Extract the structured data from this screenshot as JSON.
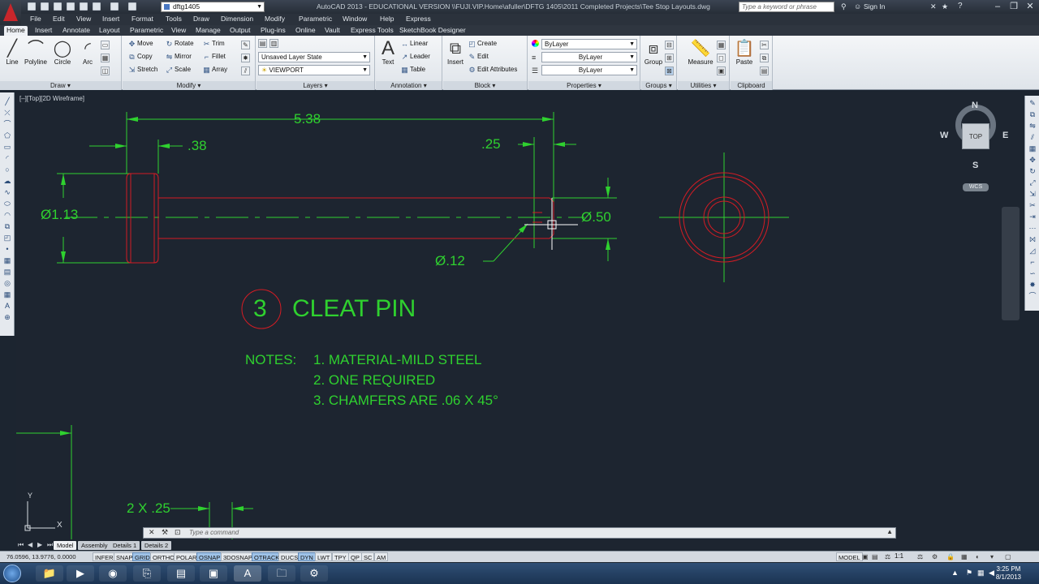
{
  "titlebar": {
    "workspace": "dftg1405",
    "title": "AutoCAD 2013 - EDUCATIONAL VERSION    \\\\FUJI.VIP.Home\\afuller\\DFTG 1405\\2011 Completed Projects\\Tee Stop Layouts.dwg",
    "search_placeholder": "Type a keyword or phrase",
    "signin": "Sign In",
    "minimize": "–",
    "restore": "❐",
    "close": "✕"
  },
  "menu": [
    "File",
    "Edit",
    "View",
    "Insert",
    "Format",
    "Tools",
    "Draw",
    "Dimension",
    "Modify",
    "Parametric",
    "Window",
    "Help",
    "Express"
  ],
  "ribbon_tabs": [
    "Home",
    "Insert",
    "Annotate",
    "Layout",
    "Parametric",
    "View",
    "Manage",
    "Output",
    "Plug-ins",
    "Online",
    "Vault",
    "Express Tools",
    "SketchBook Designer"
  ],
  "panels": {
    "draw": {
      "title": "Draw",
      "line": "Line",
      "polyline": "Polyline",
      "circle": "Circle",
      "arc": "Arc"
    },
    "modify": {
      "title": "Modify",
      "move": "Move",
      "rotate": "Rotate",
      "trim": "Trim",
      "copy": "Copy",
      "mirror": "Mirror",
      "fillet": "Fillet",
      "stretch": "Stretch",
      "scale": "Scale",
      "array": "Array"
    },
    "layers": {
      "title": "Layers",
      "layer_state": "Unsaved Layer State",
      "current_layer": "VIEWPORT"
    },
    "annotation": {
      "title": "Annotation",
      "text": "Text",
      "linear": "Linear",
      "leader": "Leader",
      "table": "Table"
    },
    "block": {
      "title": "Block",
      "insert": "Insert",
      "create": "Create",
      "edit": "Edit",
      "edit_attributes": "Edit Attributes"
    },
    "properties": {
      "title": "Properties",
      "color": "ByLayer",
      "linetype": "ByLayer",
      "lineweight": "ByLayer"
    },
    "groups": {
      "title": "Groups",
      "group": "Group"
    },
    "utilities": {
      "title": "Utilities",
      "measure": "Measure"
    },
    "clipboard": {
      "title": "Clipboard",
      "paste": "Paste"
    }
  },
  "viewport_label": "[–][Top][2D Wireframe]",
  "viewcube": {
    "top": "TOP",
    "n": "N",
    "s": "S",
    "e": "E",
    "w": "W",
    "wcs": "WCS"
  },
  "drawing": {
    "dims": {
      "length": "5.38",
      "head": ".38",
      "chamfer_len": ".25",
      "head_dia": "Ø1.13",
      "shaft_dia": "Ø.50",
      "hole_dia": "Ø.12",
      "bottom": "2 X .25"
    },
    "title_num": "3",
    "title": "CLEAT PIN",
    "notes_label": "NOTES:",
    "note1": "1. MATERIAL-MILD STEEL",
    "note2": "2. ONE REQUIRED",
    "note3": "3. CHAMFERS ARE .06 X 45°",
    "ucs_y": "Y",
    "ucs_x": "X"
  },
  "command": {
    "placeholder": "Type a command"
  },
  "layout_tabs": [
    "Model",
    "Assembly",
    "Details 1",
    "Details 2"
  ],
  "status": {
    "coords": "76.0596, 13.9776, 0.0000",
    "toggles": [
      "INFER",
      "SNAP",
      "GRID",
      "ORTHO",
      "POLAR",
      "OSNAP",
      "3DOSNAP",
      "OTRACK",
      "DUCS",
      "DYN",
      "LWT",
      "TPY",
      "QP",
      "SC",
      "AM"
    ],
    "toggles_on": [
      "GRID",
      "OSNAP",
      "OTRACK",
      "DYN"
    ],
    "model": "MODEL",
    "scale": "1:1"
  },
  "taskbar": {
    "time": "3:25 PM",
    "date": "8/1/2013"
  },
  "colors": {
    "green": "#2fd12f",
    "red": "#d41c24",
    "bg": "#1d2530"
  }
}
